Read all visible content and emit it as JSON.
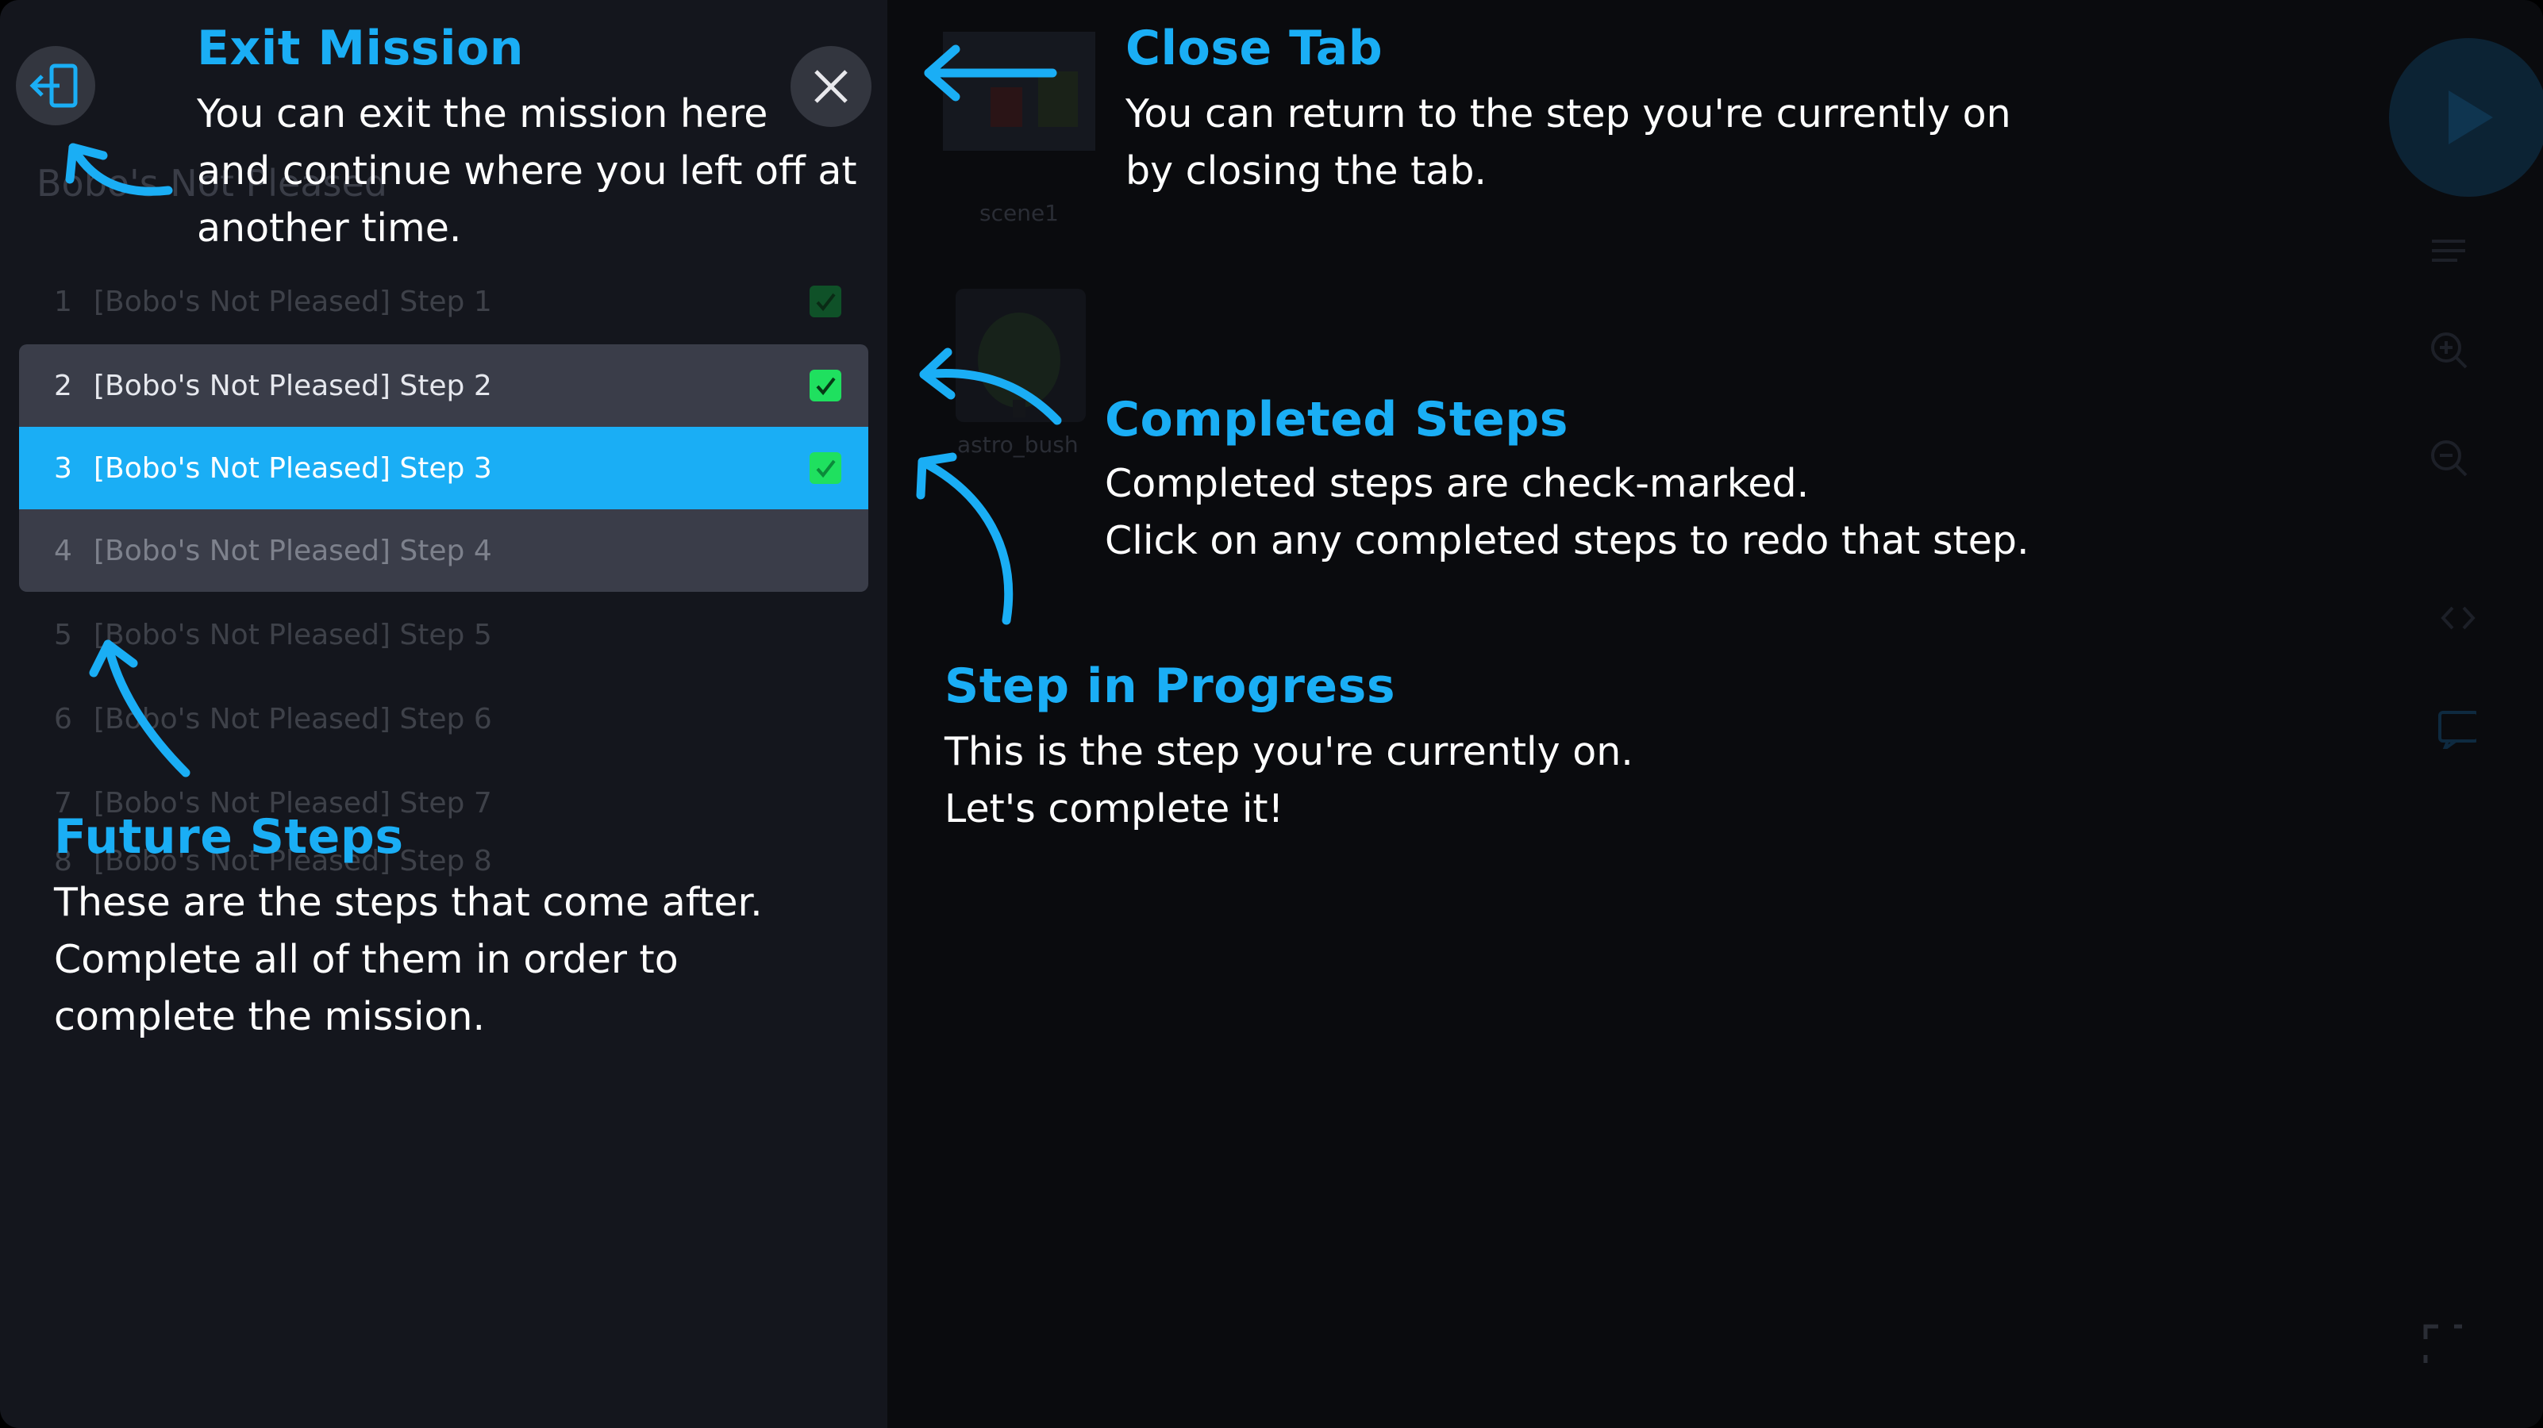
{
  "panel": {
    "title": "Bobo's Not Pleased",
    "steps": [
      {
        "num": "1",
        "label": "[Bobo's Not Pleased] Step 1",
        "state": "done-faded"
      },
      {
        "num": "2",
        "label": "[Bobo's Not Pleased] Step 2",
        "state": "done"
      },
      {
        "num": "3",
        "label": "[Bobo's Not Pleased] Step 3",
        "state": "current"
      },
      {
        "num": "4",
        "label": "[Bobo's Not Pleased] Step 4",
        "state": "next"
      },
      {
        "num": "5",
        "label": "[Bobo's Not Pleased] Step 5",
        "state": "future"
      },
      {
        "num": "6",
        "label": "[Bobo's Not Pleased] Step 6",
        "state": "future"
      },
      {
        "num": "7",
        "label": "[Bobo's Not Pleased] Step 7",
        "state": "future"
      },
      {
        "num": "8",
        "label": "[Bobo's Not Pleased] Step 8",
        "state": "future"
      }
    ]
  },
  "scene": {
    "thumb1_label": "scene1",
    "thumb2_label": "astro_bush"
  },
  "annotations": {
    "exit": {
      "heading": "Exit Mission",
      "lines": [
        "You can exit the mission here",
        "and continue where you left off at",
        "another time."
      ]
    },
    "close": {
      "heading": "Close Tab",
      "lines": [
        "You can return to the step you're currently on",
        "by closing the tab."
      ]
    },
    "completed": {
      "heading": "Completed Steps",
      "lines": [
        "Completed steps are check-marked.",
        "Click on any completed steps to redo that step."
      ]
    },
    "progress": {
      "heading": "Step in Progress",
      "lines": [
        "This is the step you're currently on.",
        "Let's complete it!"
      ]
    },
    "future": {
      "heading": "Future Steps",
      "lines": [
        "These are the steps that come after.",
        "Complete all of them in order to",
        "complete the mission."
      ]
    }
  },
  "colors": {
    "accent": "#1aaef5",
    "check": "#1fe05f",
    "panel_bg": "#14161d",
    "row_bg": "#3a3d49"
  },
  "icons": {
    "exit": "exit-door-icon",
    "close": "close-icon",
    "check": "checkmark-icon",
    "play": "play-icon"
  }
}
